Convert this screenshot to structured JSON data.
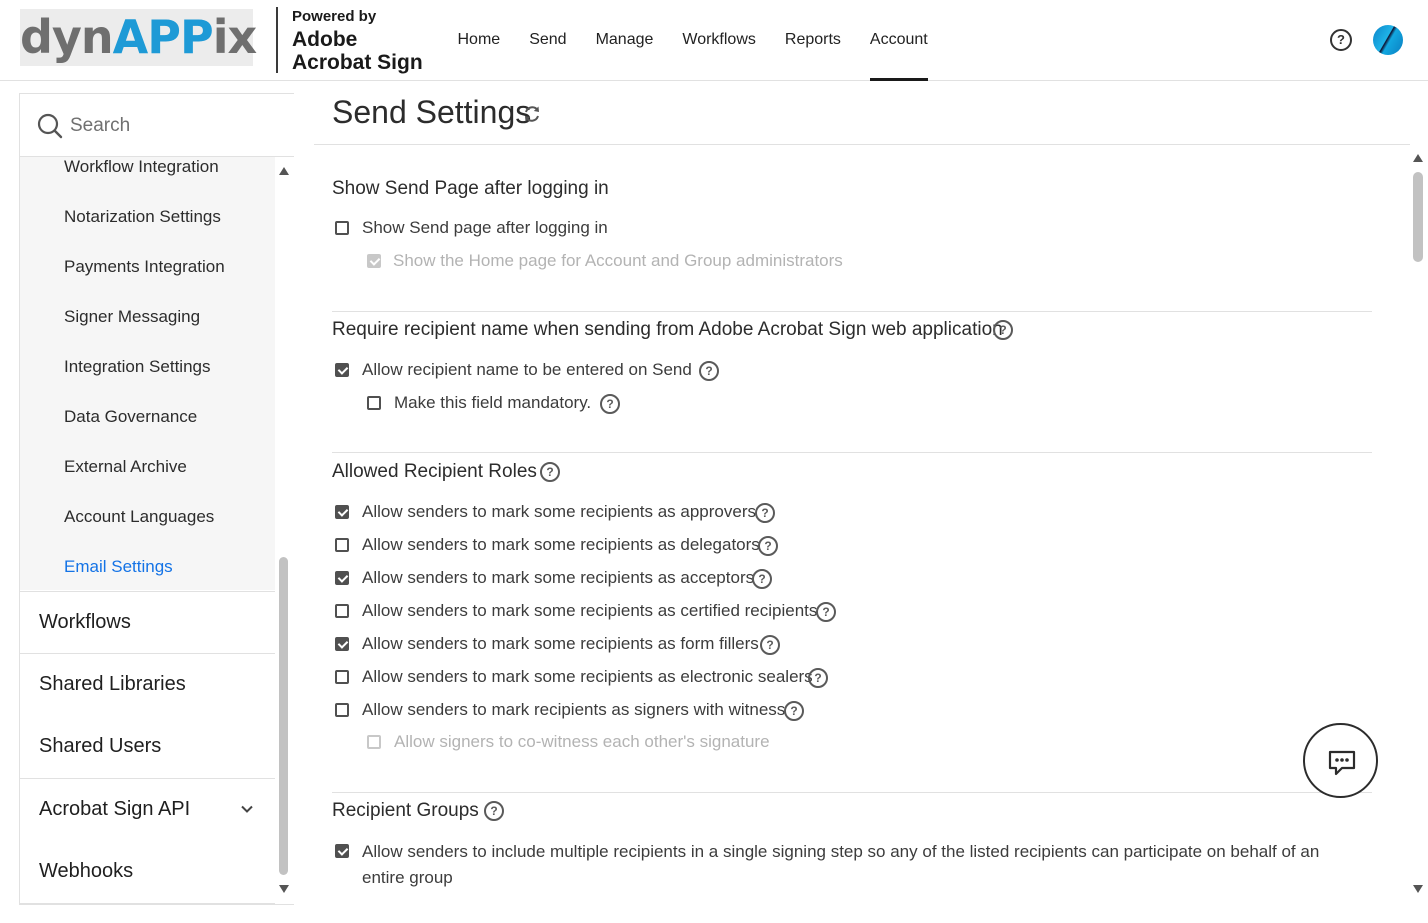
{
  "header": {
    "logo_text_dark1": "dyn",
    "logo_text_blue": "APP",
    "logo_text_dark2": "ix",
    "powered_by": "Powered by",
    "product_line1": "Adobe",
    "product_line2": "Acrobat Sign",
    "nav": [
      "Home",
      "Send",
      "Manage",
      "Workflows",
      "Reports",
      "Account"
    ],
    "active_nav": "Account",
    "help_symbol": "?"
  },
  "sidebar": {
    "search_placeholder": "Search",
    "sub_items": [
      "Workflow Integration",
      "Notarization Settings",
      "Payments Integration",
      "Signer Messaging",
      "Integration Settings",
      "Data Governance",
      "External Archive",
      "Account Languages",
      "Email Settings"
    ],
    "active_sub_item": "Email Settings",
    "main_items": [
      "Workflows",
      "Shared Libraries",
      "Shared Users",
      "Acrobat Sign API",
      "Webhooks"
    ]
  },
  "page": {
    "title": "Send Settings",
    "sections": {
      "send_page": {
        "heading": "Show Send Page after logging in",
        "opt1": "Show Send page after logging in",
        "opt2": "Show the Home page for Account and Group administrators"
      },
      "recipient_name": {
        "heading": "Require recipient name when sending from Adobe Acrobat Sign web application",
        "opt1": "Allow recipient name to be entered on Send",
        "opt2": "Make this field mandatory."
      },
      "roles": {
        "heading": "Allowed Recipient Roles",
        "opts": [
          "Allow senders to mark some recipients as approvers",
          "Allow senders to mark some recipients as delegators",
          "Allow senders to mark some recipients as acceptors",
          "Allow senders to mark some recipients as certified recipients",
          "Allow senders to mark some recipients as form fillers",
          "Allow senders to mark some recipients as electronic sealers",
          "Allow senders to mark recipients as signers with witness"
        ],
        "sub_opt": "Allow signers to co-witness each other's signature"
      },
      "groups": {
        "heading": "Recipient Groups",
        "opt1": "Allow senders to include multiple recipients in a single signing step so any of the listed recipients can participate on behalf of an entire group"
      }
    }
  },
  "colors": {
    "accent": "#1473e6",
    "logo_blue": "#1e9ad6",
    "text": "#2c2c2c",
    "divider": "#e1e1e1"
  },
  "icons": [
    "search-icon",
    "refresh-icon",
    "help-icon",
    "chevron-down-icon",
    "chat-icon"
  ]
}
